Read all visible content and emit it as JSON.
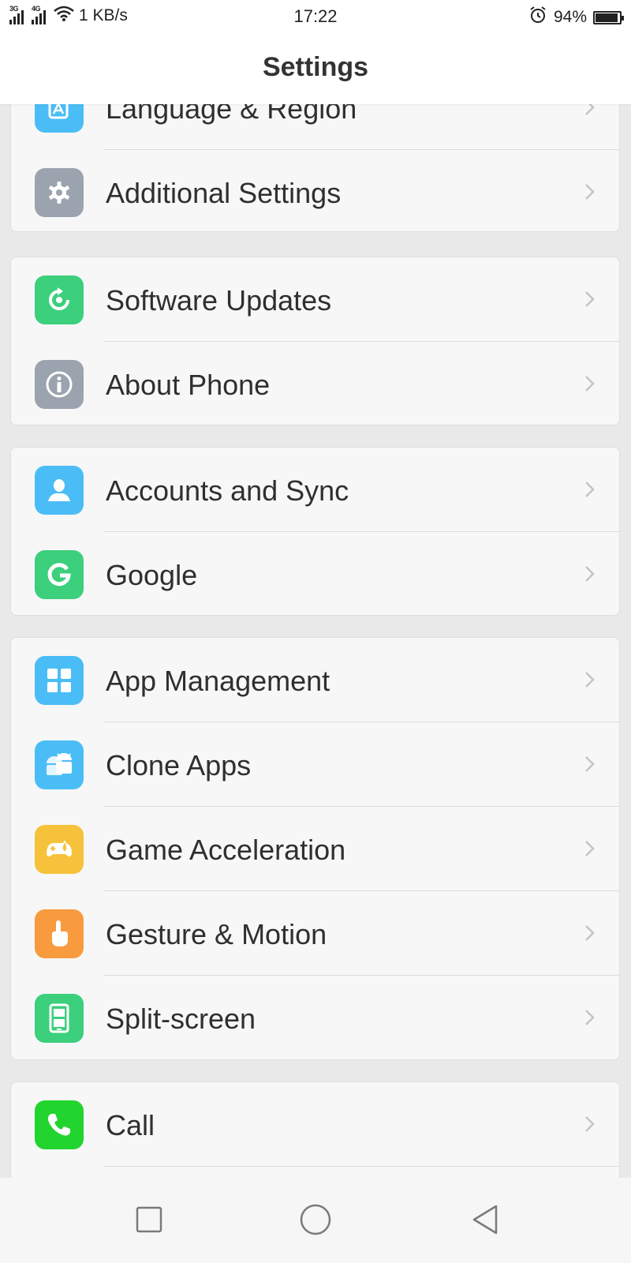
{
  "status_bar": {
    "net1": "3G",
    "net2": "4G",
    "speed": "1 KB/s",
    "time": "17:22",
    "battery_text": "94%",
    "battery_level": 0.94
  },
  "header": {
    "title": "Settings"
  },
  "groups": [
    {
      "items": [
        {
          "label": "Language & Region",
          "icon": "language-icon",
          "color": "#4bbdf6"
        },
        {
          "label": "Additional Settings",
          "icon": "gear-icon",
          "color": "#9aa3ae"
        }
      ]
    },
    {
      "items": [
        {
          "label": "Software Updates",
          "icon": "update-icon",
          "color": "#3ccf7c"
        },
        {
          "label": "About Phone",
          "icon": "info-icon",
          "color": "#9aa3ae"
        }
      ]
    },
    {
      "items": [
        {
          "label": "Accounts and Sync",
          "icon": "account-icon",
          "color": "#4bbdf6"
        },
        {
          "label": "Google",
          "icon": "google-icon",
          "color": "#3ccf7c"
        }
      ]
    },
    {
      "items": [
        {
          "label": "App Management",
          "icon": "apps-grid-icon",
          "color": "#4bbdf6"
        },
        {
          "label": "Clone Apps",
          "icon": "android-clone-icon",
          "color": "#4bbdf6"
        },
        {
          "label": "Game Acceleration",
          "icon": "gamepad-rocket-icon",
          "color": "#f7c23b"
        },
        {
          "label": "Gesture & Motion",
          "icon": "hand-pointer-icon",
          "color": "#f89a3e"
        },
        {
          "label": "Split-screen",
          "icon": "split-screen-icon",
          "color": "#3ccf7c"
        }
      ]
    },
    {
      "items": [
        {
          "label": "Call",
          "icon": "phone-icon",
          "color": "#22d42e"
        }
      ]
    }
  ],
  "nav": {
    "recent": "recent-apps-icon",
    "home": "home-circle-icon",
    "back": "back-triangle-icon"
  }
}
